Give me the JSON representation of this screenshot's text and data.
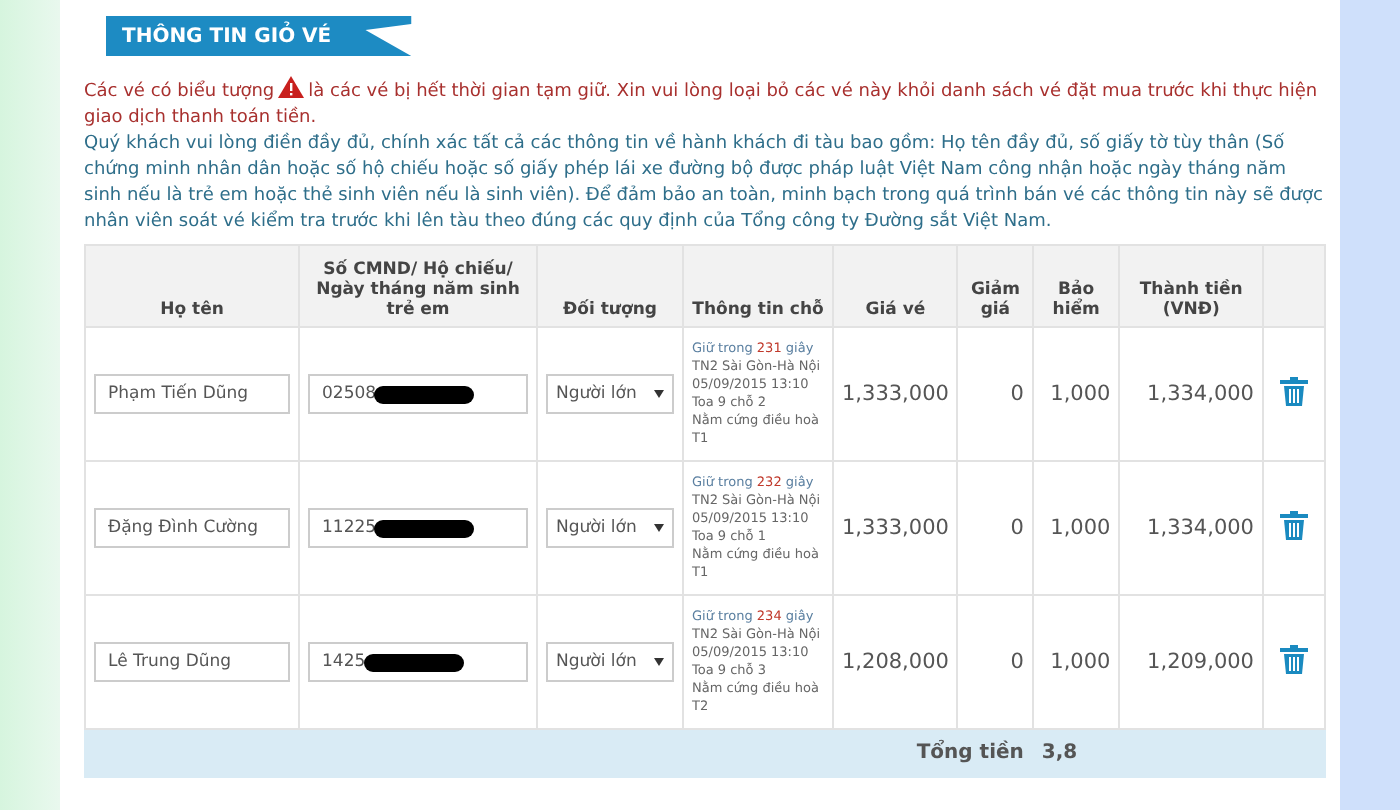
{
  "section_title": "THÔNG TIN GIỎ VÉ",
  "notice": {
    "before_icon": "Các vé có biểu tượng",
    "after_icon": "là các vé bị hết thời gian tạm giữ. Xin vui lòng loại bỏ các vé này khỏi danh sách vé đặt mua trước khi thực hiện giao dịch thanh toán tiền."
  },
  "instructions": "Quý khách vui lòng điền đầy đủ, chính xác tất cả các thông tin về hành khách đi tàu bao gồm: Họ tên đầy đủ, số giấy tờ tùy thân (Số chứng minh nhân dân hoặc số hộ chiếu hoặc số giấy phép lái xe đường bộ được pháp luật Việt Nam công nhận hoặc ngày tháng năm sinh nếu là trẻ em hoặc thẻ sinh viên nếu là sinh viên). Để đảm bảo an toàn, minh bạch trong quá trình bán vé các thông tin này sẽ được nhân viên soát vé kiểm tra trước khi lên tàu theo đúng các quy định của Tổng công ty Đường sắt Việt Nam.",
  "table": {
    "columns": [
      "Họ tên",
      "Số CMND/ Hộ chiếu/ Ngày tháng năm sinh trẻ em",
      "Đối tượng",
      "Thông tin chỗ",
      "Giá vé",
      "Giảm giá",
      "Bảo hiểm",
      "Thành tiền (VNĐ)"
    ],
    "rows": [
      {
        "name": "Phạm Tiến Dũng",
        "id_number": "02508",
        "passenger_type": "Người lớn",
        "hold_prefix": "Giữ trong",
        "hold_seconds": "231",
        "hold_suffix": "giây",
        "seat_lines": [
          "TN2 Sài Gòn-Hà Nội",
          "05/09/2015 13:10",
          "Toa 9 chỗ 2",
          "Nằm cứng điều hoà T1"
        ],
        "price": "1,333,000",
        "discount": "0",
        "insurance": "1,000",
        "total": "1,334,000"
      },
      {
        "name": "Đặng Đình Cường",
        "id_number": "11225",
        "passenger_type": "Người lớn",
        "hold_prefix": "Giữ trong",
        "hold_seconds": "232",
        "hold_suffix": "giây",
        "seat_lines": [
          "TN2 Sài Gòn-Hà Nội",
          "05/09/2015 13:10",
          "Toa 9 chỗ 1",
          "Nằm cứng điều hoà T1"
        ],
        "price": "1,333,000",
        "discount": "0",
        "insurance": "1,000",
        "total": "1,334,000"
      },
      {
        "name": "Lê Trung Dũng",
        "id_number": "1425",
        "passenger_type": "Người lớn",
        "hold_prefix": "Giữ trong",
        "hold_seconds": "234",
        "hold_suffix": "giây",
        "seat_lines": [
          "TN2 Sài Gòn-Hà Nội",
          "05/09/2015 13:10",
          "Toa 9 chỗ 3",
          "Nằm cứng điều hoà T2"
        ],
        "price": "1,208,000",
        "discount": "0",
        "insurance": "1,000",
        "total": "1,209,000"
      }
    ],
    "footer": {
      "label": "Tổng tiền",
      "value": "3,8"
    }
  }
}
